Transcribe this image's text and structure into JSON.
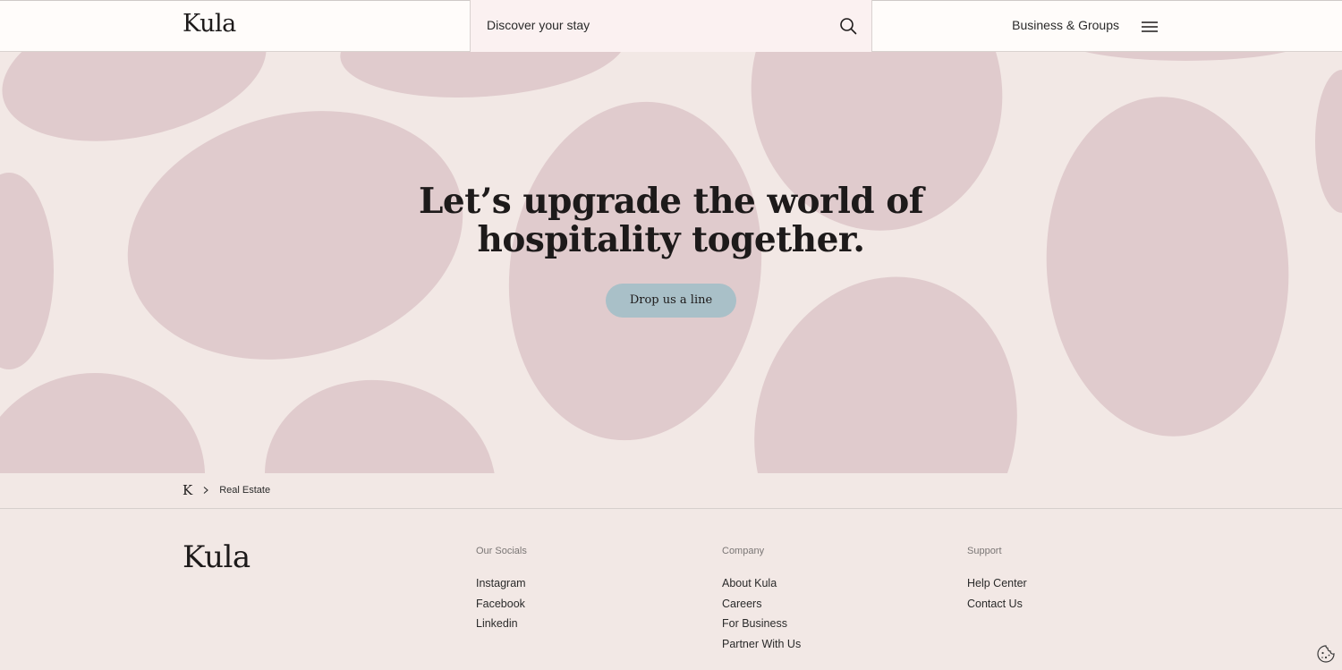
{
  "header": {
    "logo": "Kula",
    "search_placeholder": "Discover your stay",
    "business_link": "Business & Groups",
    "icons": [
      "search-icon",
      "menu-icon"
    ]
  },
  "hero": {
    "title_line1": "Let’s upgrade the world of",
    "title_line2": "hospitality together.",
    "cta_label": "Drop us a line"
  },
  "breadcrumb": {
    "home": "K",
    "current": "Real Estate"
  },
  "footer": {
    "logo": "Kula",
    "socials": {
      "title": "Our Socials",
      "links": [
        "Instagram",
        "Facebook",
        "Linkedin"
      ]
    },
    "company": {
      "title": "Company",
      "links": [
        "About Kula",
        "Careers",
        "For Business",
        "Partner With Us"
      ]
    },
    "support": {
      "title": "Support",
      "links": [
        "Help Center",
        "Contact Us"
      ]
    }
  },
  "colors": {
    "background": "#f2e8e5",
    "blob": "#e0cbcd",
    "header": "#fffcfa",
    "search_bg": "#fbf1f1",
    "cta": "#a9c0c8",
    "text": "#1d1a1a"
  }
}
